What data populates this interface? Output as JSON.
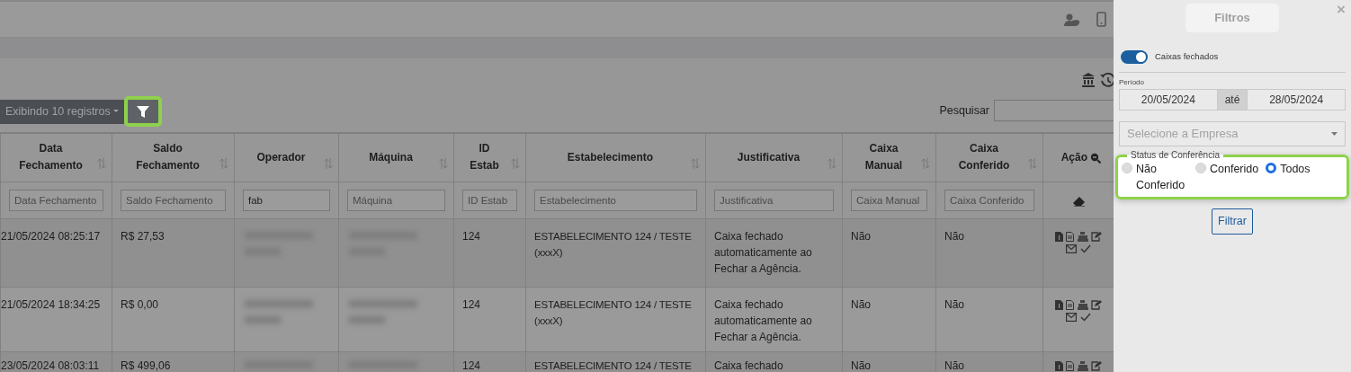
{
  "toolbar": {
    "length_menu": "Exibindo 10 registros",
    "search_label": "Pesquisar"
  },
  "table": {
    "columns": [
      {
        "label": "Data Fechamento",
        "sortable": true,
        "filter": {
          "placeholder": "Data Fechamento"
        }
      },
      {
        "label": "Saldo Fechamento",
        "sortable": true,
        "filter": {
          "placeholder": "Saldo Fechamento"
        }
      },
      {
        "label": "Operador",
        "sortable": true,
        "filter": {
          "value": "fab"
        }
      },
      {
        "label": "Máquina",
        "sortable": true,
        "filter": {
          "placeholder": "Máquina"
        }
      },
      {
        "label": "ID Estab",
        "sortable": true,
        "filter": {
          "placeholder": "ID Estab"
        }
      },
      {
        "label": "Estabelecimento",
        "sortable": true,
        "filter": {
          "placeholder": "Estabelecimento"
        }
      },
      {
        "label": "Justificativa",
        "sortable": true,
        "filter": {
          "placeholder": "Justificativa"
        }
      },
      {
        "label": "Caixa Manual",
        "sortable": true,
        "filter": {
          "placeholder": "Caixa Manual"
        }
      },
      {
        "label": "Caixa Conferido",
        "sortable": true,
        "filter": {
          "placeholder": "Caixa Conferido"
        }
      },
      {
        "label": "Ação",
        "sortable": false,
        "filter": {
          "kind": "clear"
        }
      }
    ],
    "rows": [
      {
        "cells": [
          {
            "kind": "text",
            "text": "21/05/2024 08:25:17"
          },
          {
            "kind": "text",
            "text": "R$ 27,53"
          },
          {
            "kind": "redacted"
          },
          {
            "kind": "redacted"
          },
          {
            "kind": "text",
            "text": "124"
          },
          {
            "kind": "text",
            "text": "ESTABELECIMENTO 124 / TESTE (xxxX)"
          },
          {
            "kind": "text",
            "text": "Caixa fechado automaticamente ao Fechar a Agência."
          },
          {
            "kind": "text",
            "text": "Não"
          },
          {
            "kind": "text",
            "text": "Não"
          },
          {
            "kind": "actions"
          }
        ]
      },
      {
        "cells": [
          {
            "kind": "text",
            "text": "21/05/2024 18:34:25"
          },
          {
            "kind": "text",
            "text": "R$ 0,00"
          },
          {
            "kind": "redacted"
          },
          {
            "kind": "redacted"
          },
          {
            "kind": "text",
            "text": "124"
          },
          {
            "kind": "text",
            "text": "ESTABELECIMENTO 124 / TESTE (xxxX)"
          },
          {
            "kind": "text",
            "text": "Caixa fechado automaticamente ao Fechar a Agência."
          },
          {
            "kind": "text",
            "text": "Não"
          },
          {
            "kind": "text",
            "text": "Não"
          },
          {
            "kind": "actions"
          }
        ]
      },
      {
        "cells": [
          {
            "kind": "text",
            "text": "23/05/2024 08:03:11"
          },
          {
            "kind": "text",
            "text": "R$ 499,06"
          },
          {
            "kind": "redacted"
          },
          {
            "kind": "redacted"
          },
          {
            "kind": "text",
            "text": "124"
          },
          {
            "kind": "text",
            "text": "ESTABELECIMENTO 124 / TESTE"
          },
          {
            "kind": "text",
            "text": "Caixa fechado"
          },
          {
            "kind": "text",
            "text": "Não"
          },
          {
            "kind": "text",
            "text": "Não"
          },
          {
            "kind": "actions-cut"
          }
        ]
      }
    ]
  },
  "panel": {
    "title": "Filtros",
    "close": "×",
    "toggle": {
      "label": "Caixas fechados",
      "on": true
    },
    "period": {
      "label": "Período",
      "from": "20/05/2024",
      "separator": "até",
      "to": "28/05/2024"
    },
    "company_select": {
      "placeholder": "Selecione a Empresa"
    },
    "status": {
      "legend": "Status de Conferência",
      "options": [
        {
          "label": "Não Conferido",
          "selected": false
        },
        {
          "label": "Conferido",
          "selected": false
        },
        {
          "label": "Todos",
          "selected": true
        }
      ]
    },
    "button": "Filtrar"
  }
}
